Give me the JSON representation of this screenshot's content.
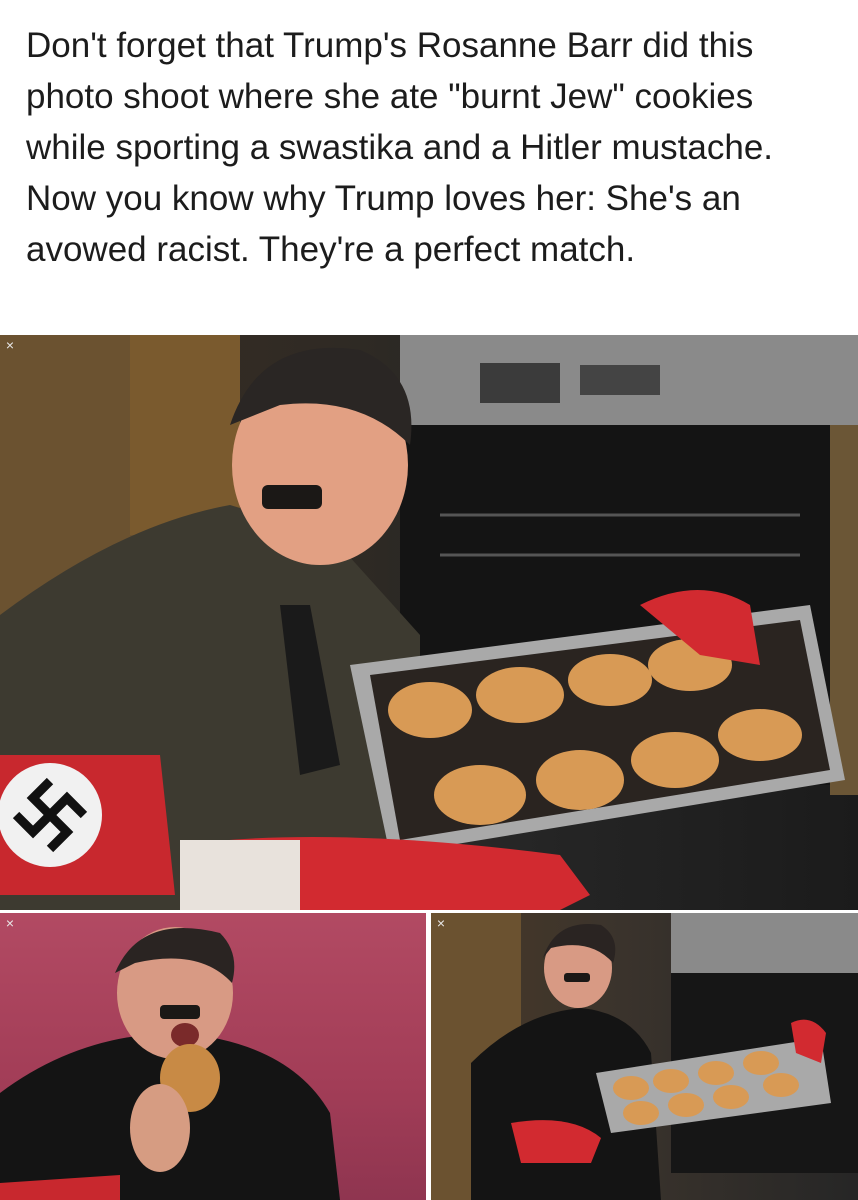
{
  "post": {
    "caption": "Don't forget that Trump's Rosanne Barr did this photo shoot where she ate \"burnt Jew\" cookies while sporting a swastika and a Hitler mustache. Now you know why Trump loves her: She's an avowed racist. They're a perfect match."
  },
  "images": [
    {
      "close_glyph": "×"
    },
    {
      "close_glyph": "×"
    },
    {
      "close_glyph": "×"
    }
  ],
  "colors": {
    "caption_text": "#1c1c1c",
    "background": "#ffffff",
    "armband_red": "#c8282e",
    "mitt_red": "#d22a30",
    "cookie": "#d89a55",
    "backdrop_pink": "#a83f59"
  }
}
